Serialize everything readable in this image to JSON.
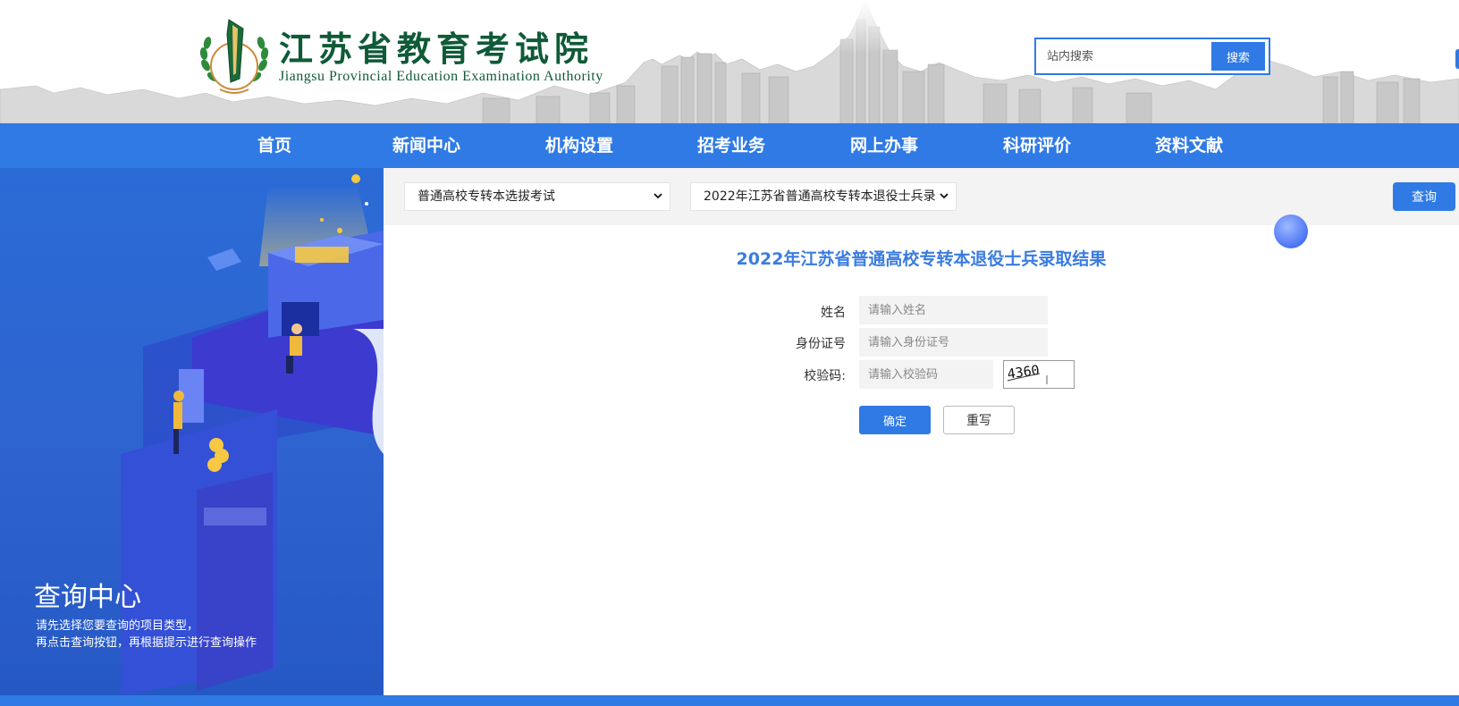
{
  "header": {
    "logo_cn": "江苏省教育考试院",
    "logo_en": "Jiangsu Provincial Education Examination Authority",
    "search_placeholder": "站内搜索",
    "search_button": "搜索"
  },
  "nav": {
    "items": [
      "首页",
      "新闻中心",
      "机构设置",
      "招考业务",
      "网上办事",
      "科研评价",
      "资料文献"
    ]
  },
  "left_panel": {
    "title": "查询中心",
    "desc_line1": "请先选择您要查询的项目类型，",
    "desc_line2": "再点击查询按钮，再根据提示进行查询操作"
  },
  "filter": {
    "select1_value": "普通高校专转本选拔考试",
    "select2_value": "2022年江苏省普通高校专转本退役士兵录",
    "query_button": "查询"
  },
  "result": {
    "title": "2022年江苏省普通高校专转本退役士兵录取结果"
  },
  "form": {
    "name_label": "姓名",
    "name_placeholder": "请输入姓名",
    "id_label": "身份证号",
    "id_placeholder": "请输入身份证号",
    "code_label": "校验码:",
    "code_placeholder": "请输入校验码",
    "captcha_text": "4360",
    "ok_button": "确定",
    "reset_button": "重写"
  },
  "colors": {
    "primary": "#2f7ae5",
    "logo_green": "#0f5a37",
    "title_blue": "#3a7ce0"
  }
}
